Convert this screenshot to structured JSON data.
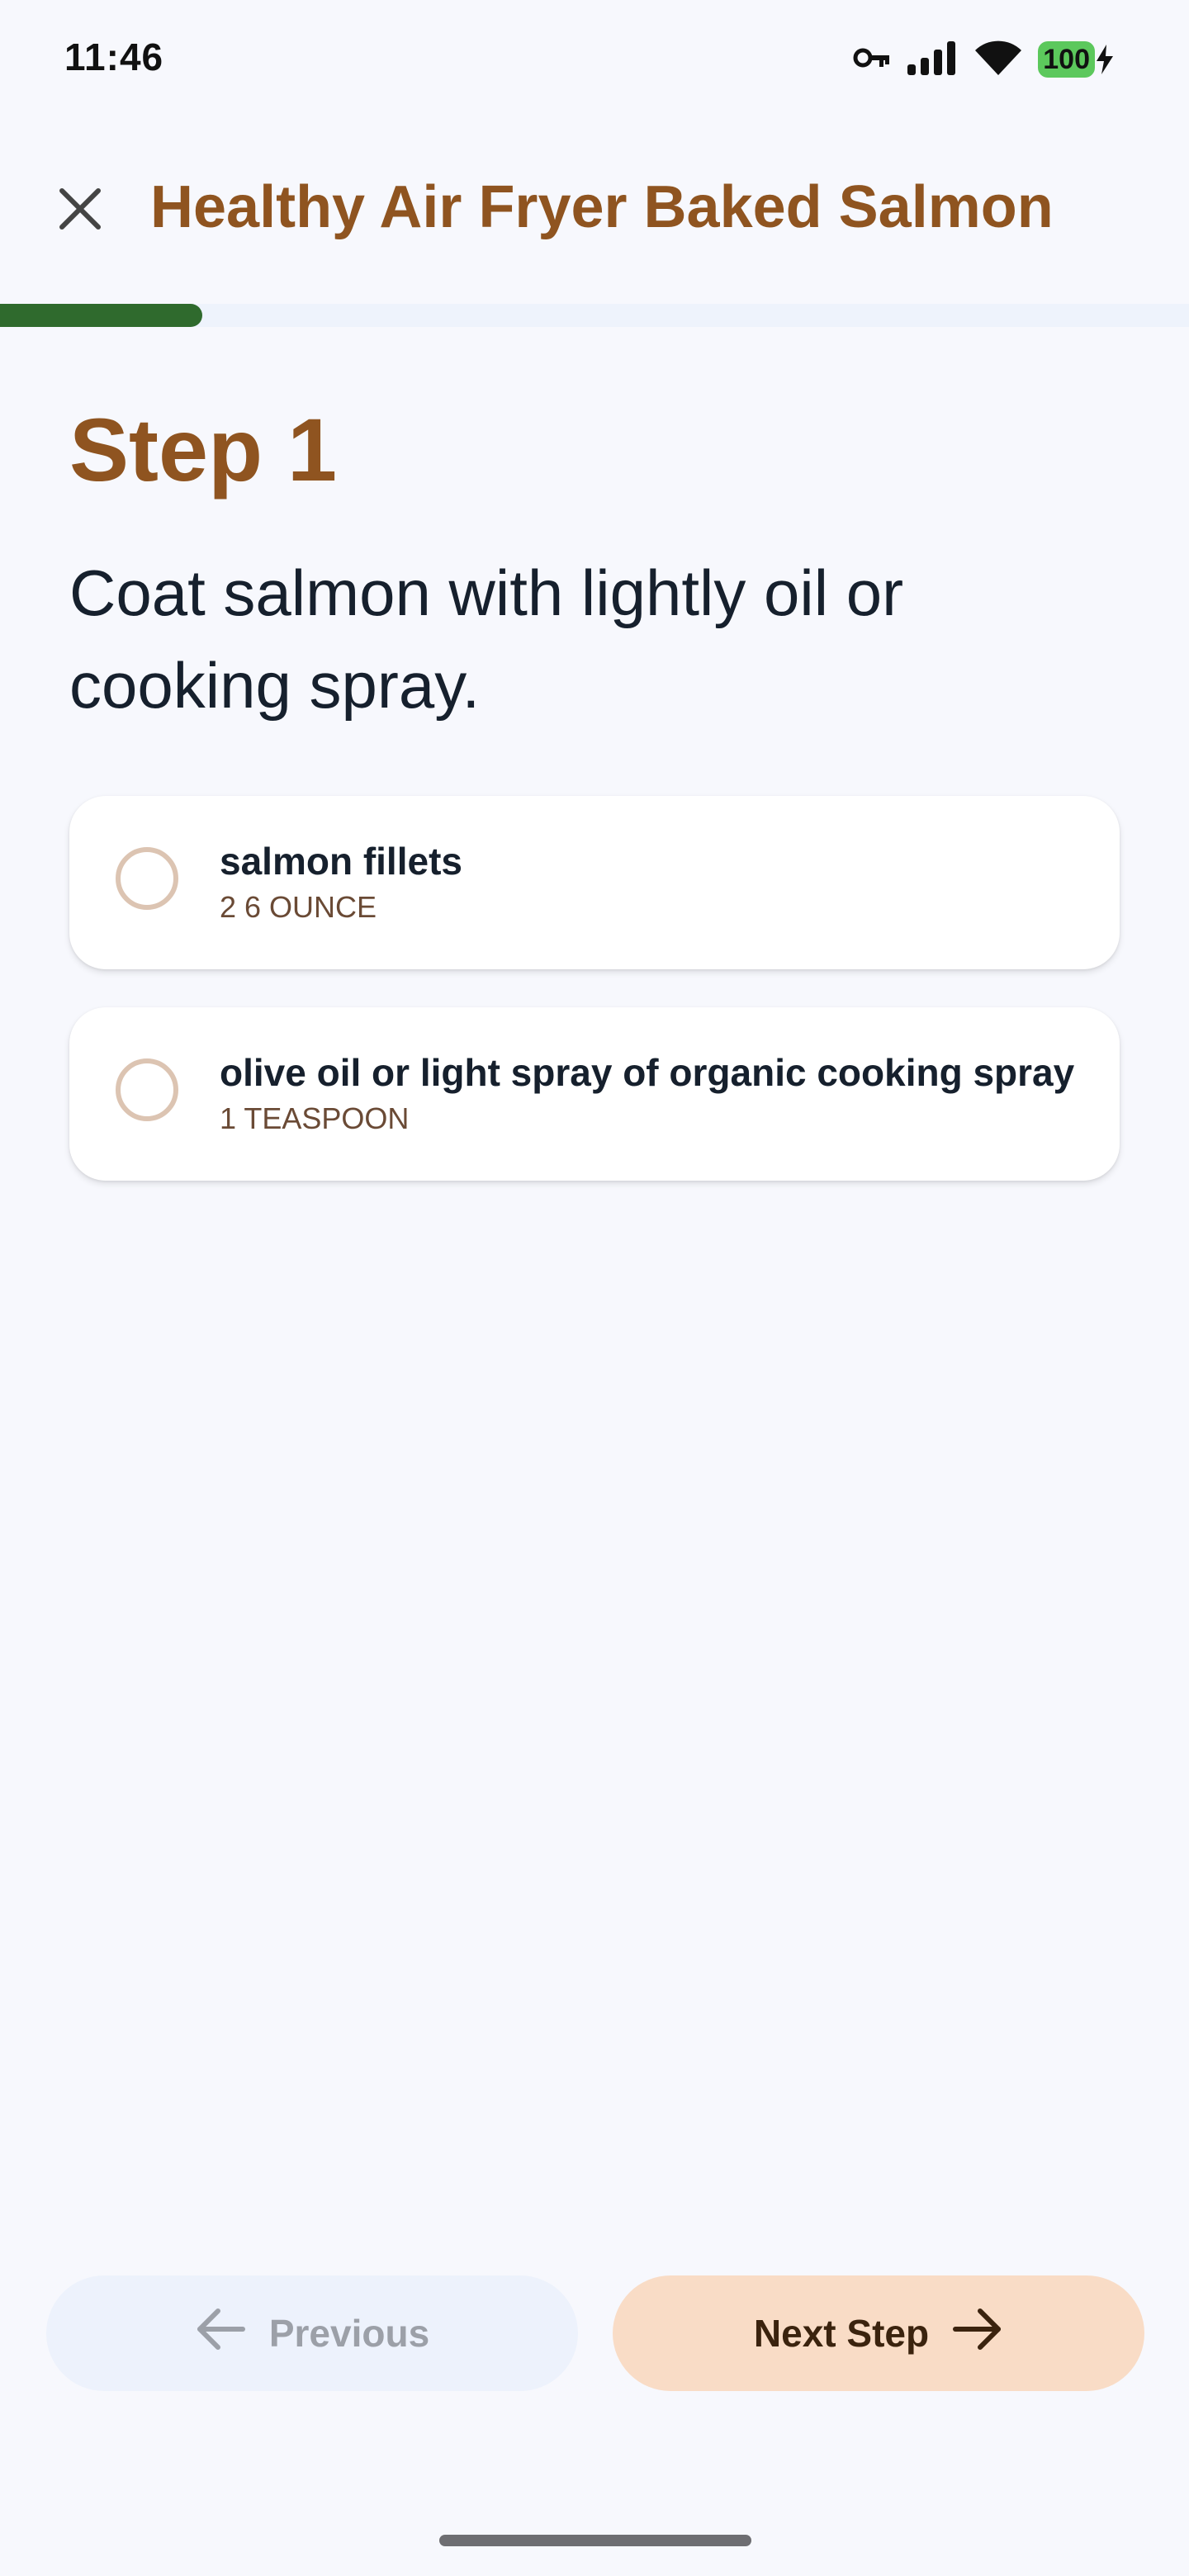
{
  "status_bar": {
    "time": "11:46",
    "battery": "100",
    "icons": [
      "vpn-key-icon",
      "signal-icon",
      "wifi-icon",
      "battery-charging-icon"
    ]
  },
  "header": {
    "title": "Healthy Air Fryer Baked Salmon",
    "close_icon": "close-icon"
  },
  "progress": {
    "fraction": 0.17,
    "fill_color": "#2f6a2d"
  },
  "step": {
    "title": "Step 1",
    "instruction": "Coat salmon with lightly oil or cooking spray."
  },
  "ingredients": [
    {
      "name": "salmon fillets",
      "quantity": "2 6 OUNCE",
      "checked": false
    },
    {
      "name": "olive oil or light spray of organic cooking spray",
      "quantity": "1 TEASPOON",
      "checked": false
    }
  ],
  "navigation": {
    "previous_label": "Previous",
    "next_label": "Next Step",
    "previous_enabled": false
  },
  "colors": {
    "accent": "#8f5420",
    "background": "#f7f8fd",
    "next_button": "#f9dcc6",
    "previous_button": "#edf2fc"
  }
}
